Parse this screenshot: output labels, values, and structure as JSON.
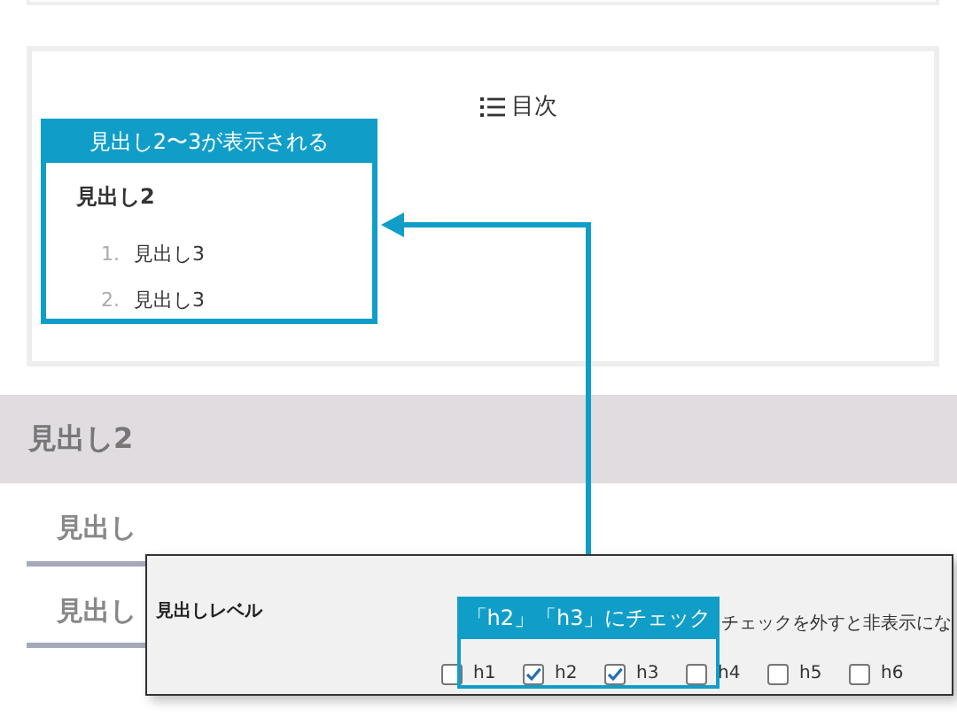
{
  "toc": {
    "title": "目次"
  },
  "toc_callout": {
    "caption": "見出し2〜3が表示される",
    "heading": "見出し2",
    "items": [
      {
        "number": "1.",
        "label": "見出し3"
      },
      {
        "number": "2.",
        "label": "見出し3"
      }
    ]
  },
  "section_heading": "見出し2",
  "subheadings": [
    "見出し",
    "見出し"
  ],
  "settings_panel": {
    "label": "見出しレベル",
    "description": "チェックを外すと非表示にな",
    "levels": [
      {
        "label": "h1",
        "checked": false
      },
      {
        "label": "h2",
        "checked": true
      },
      {
        "label": "h3",
        "checked": true
      },
      {
        "label": "h4",
        "checked": false
      },
      {
        "label": "h5",
        "checked": false
      },
      {
        "label": "h6",
        "checked": false
      }
    ]
  },
  "checkbox_callout": {
    "caption": "「h2」「h3」にチェック"
  }
}
